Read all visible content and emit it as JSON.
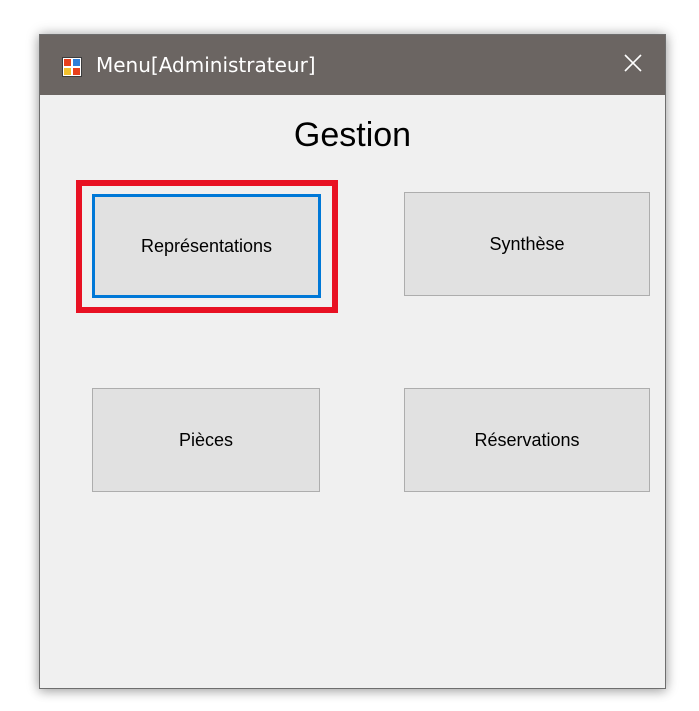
{
  "window": {
    "title": "Menu[Administrateur]",
    "app_icon": "form-app-icon",
    "close_icon": "close-icon"
  },
  "main": {
    "heading": "Gestion",
    "buttons": [
      {
        "label": "Représentations",
        "focused": true,
        "highlighted": true
      },
      {
        "label": "Synthèse"
      },
      {
        "label": "Pièces"
      },
      {
        "label": "Réservations"
      }
    ]
  },
  "colors": {
    "titlebar": "#6b6562",
    "window_bg": "#f0f0f0",
    "button_bg": "#e1e1e1",
    "button_border": "#adadad",
    "focus_border": "#0078d7",
    "highlight": "#e81123"
  }
}
